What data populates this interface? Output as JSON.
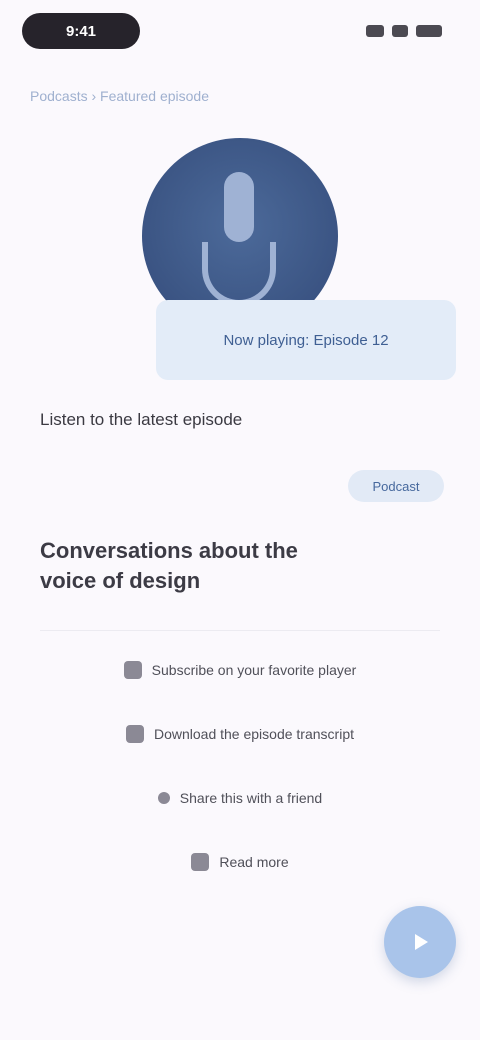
{
  "status_bar": {
    "time": "9:41"
  },
  "breadcrumb": "Podcasts › Featured episode",
  "hero": {
    "caption": "Now playing: Episode 12"
  },
  "section_heading": "Listen to the latest episode",
  "tag": "Podcast",
  "page_title": "Conversations about the voice of design",
  "options": [
    {
      "label": "Subscribe on your favorite player",
      "icon": "rss-icon"
    },
    {
      "label": "Download the episode transcript",
      "icon": "document-icon"
    },
    {
      "label": "Share this with a friend",
      "icon": "share-icon"
    },
    {
      "label": "Read more",
      "icon": "book-icon"
    }
  ],
  "fab": {
    "icon": "play-icon"
  }
}
